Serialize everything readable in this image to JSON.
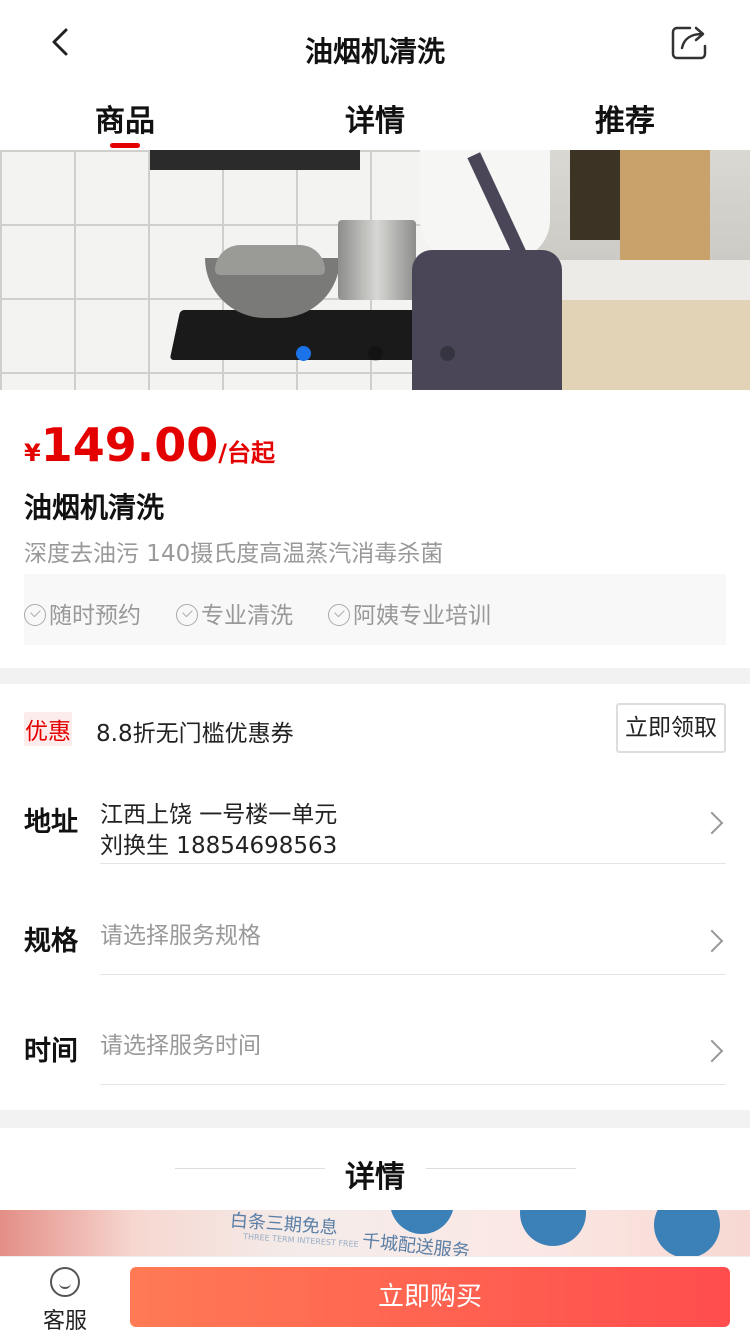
{
  "header": {
    "title": "油烟机清洗",
    "back_icon": "chevron-left-icon",
    "share_icon": "share-icon"
  },
  "tabs": [
    {
      "label": "商品",
      "active": true
    },
    {
      "label": "详情",
      "active": false
    },
    {
      "label": "推荐",
      "active": false
    }
  ],
  "carousel": {
    "slide_count": 3,
    "active_index": 0,
    "active_color": "#1a73e8"
  },
  "product": {
    "currency": "¥",
    "price": "149.00",
    "price_unit": "/台起",
    "name": "油烟机清洗",
    "subtitle": "深度去油污 140摄氏度高温蒸汽消毒杀菌",
    "features": [
      "随时预约",
      "专业清洗",
      "阿姨专业培训"
    ]
  },
  "coupon": {
    "tag": "优惠",
    "text": "8.8折无门槛优惠券",
    "button": "立即领取"
  },
  "address": {
    "label": "地址",
    "line1": "江西上饶 一号楼一单元",
    "line2": "刘换生 18854698563"
  },
  "spec": {
    "label": "规格",
    "placeholder": "请选择服务规格"
  },
  "time": {
    "label": "时间",
    "placeholder": "请选择服务时间"
  },
  "details": {
    "title": "详情",
    "banner_text_1": "白条三期免息",
    "banner_text_2": "THREE TERM INTEREST FREE",
    "banner_text_3": "千城配送服务"
  },
  "bottom": {
    "service_label": "客服",
    "service_icon": "smiley-icon",
    "buy_button": "立即购买"
  },
  "colors": {
    "accent": "#e50000",
    "buy_gradient_start": "#ff7a55",
    "buy_gradient_end": "#ff4d4d"
  }
}
